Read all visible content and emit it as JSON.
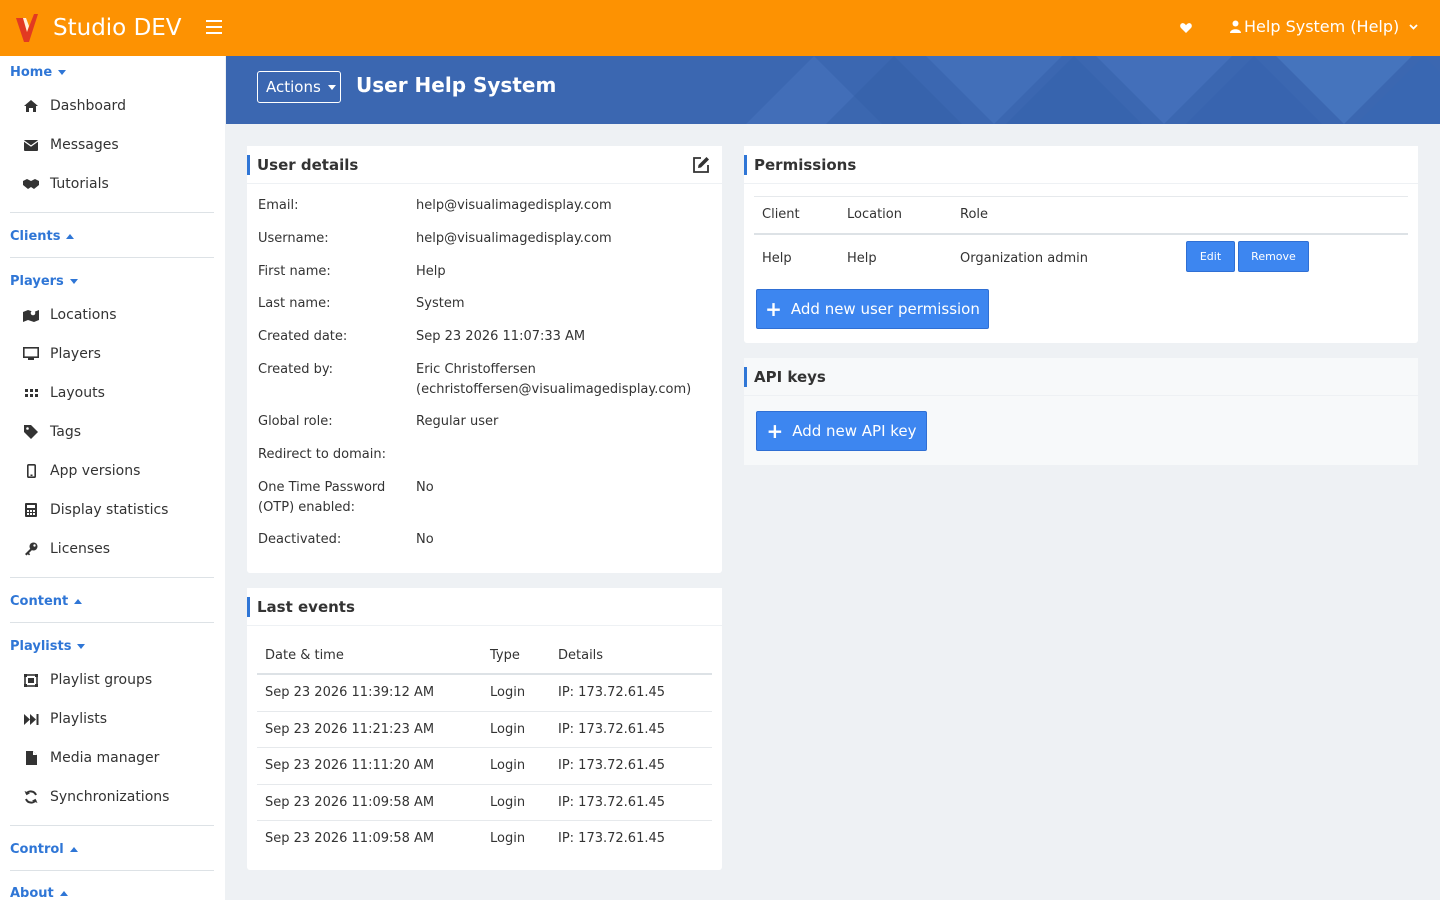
{
  "app": {
    "name": "Studio DEV",
    "user_menu": "Help System (Help)"
  },
  "sidebar": {
    "sections": [
      {
        "title": "Home",
        "state": "expanded",
        "items": [
          {
            "label": "Dashboard",
            "icon": "home-icon"
          },
          {
            "label": "Messages",
            "icon": "envelope-icon"
          },
          {
            "label": "Tutorials",
            "icon": "handshake-icon"
          }
        ]
      },
      {
        "title": "Clients",
        "state": "collapsed",
        "items": []
      },
      {
        "title": "Players",
        "state": "expanded",
        "items": [
          {
            "label": "Locations",
            "icon": "map-icon"
          },
          {
            "label": "Players",
            "icon": "desktop-icon"
          },
          {
            "label": "Layouts",
            "icon": "grid-icon"
          },
          {
            "label": "Tags",
            "icon": "tag-icon"
          },
          {
            "label": "App versions",
            "icon": "mobile-icon"
          },
          {
            "label": "Display statistics",
            "icon": "calculator-icon"
          },
          {
            "label": "Licenses",
            "icon": "key-icon"
          }
        ]
      },
      {
        "title": "Content",
        "state": "collapsed",
        "items": []
      },
      {
        "title": "Playlists",
        "state": "expanded",
        "items": [
          {
            "label": "Playlist groups",
            "icon": "object-group-icon"
          },
          {
            "label": "Playlists",
            "icon": "fast-forward-icon"
          },
          {
            "label": "Media manager",
            "icon": "file-icon"
          },
          {
            "label": "Synchronizations",
            "icon": "sync-icon"
          }
        ]
      },
      {
        "title": "Control",
        "state": "collapsed",
        "items": []
      },
      {
        "title": "About",
        "state": "collapsed",
        "items": []
      }
    ]
  },
  "header": {
    "actions_label": "Actions",
    "title": "User Help System"
  },
  "user_details": {
    "title": "User details",
    "rows": [
      {
        "label": "Email:",
        "value": "help@visualimagedisplay.com"
      },
      {
        "label": "Username:",
        "value": "help@visualimagedisplay.com"
      },
      {
        "label": "First name:",
        "value": "Help"
      },
      {
        "label": "Last name:",
        "value": "System"
      },
      {
        "label": "Created date:",
        "value": "Sep 23 2026 11:07:33 AM"
      },
      {
        "label": "Created by:",
        "value": "Eric Christoffersen",
        "value2": "(echristoffersen@visualimagedisplay.com)"
      },
      {
        "label": "Global role:",
        "value": "Regular user"
      },
      {
        "label": "Redirect to domain:",
        "value": ""
      },
      {
        "label": "One Time Password",
        "label2": "(OTP) enabled:",
        "value": "No"
      },
      {
        "label": "Deactivated:",
        "value": "No"
      }
    ]
  },
  "last_events": {
    "title": "Last events",
    "columns": [
      "Date & time",
      "Type",
      "Details"
    ],
    "rows": [
      [
        "Sep 23 2026 11:39:12 AM",
        "Login",
        "IP: 173.72.61.45"
      ],
      [
        "Sep 23 2026 11:21:23 AM",
        "Login",
        "IP: 173.72.61.45"
      ],
      [
        "Sep 23 2026 11:11:20 AM",
        "Login",
        "IP: 173.72.61.45"
      ],
      [
        "Sep 23 2026 11:09:58 AM",
        "Login",
        "IP: 173.72.61.45"
      ],
      [
        "Sep 23 2026 11:09:58 AM",
        "Login",
        "IP: 173.72.61.45"
      ]
    ]
  },
  "permissions": {
    "title": "Permissions",
    "columns": [
      "Client",
      "Location",
      "Role"
    ],
    "rows": [
      {
        "client": "Help",
        "location": "Help",
        "role": "Organization admin",
        "edit": "Edit",
        "remove": "Remove"
      }
    ],
    "add_label": "Add new user permission"
  },
  "api_keys": {
    "title": "API keys",
    "add_label": "Add new API key"
  },
  "colors": {
    "topbar": "#fd9202",
    "header_band": "#3b67b1",
    "accent": "#2f76d6",
    "primary_button": "#3d86f0"
  }
}
